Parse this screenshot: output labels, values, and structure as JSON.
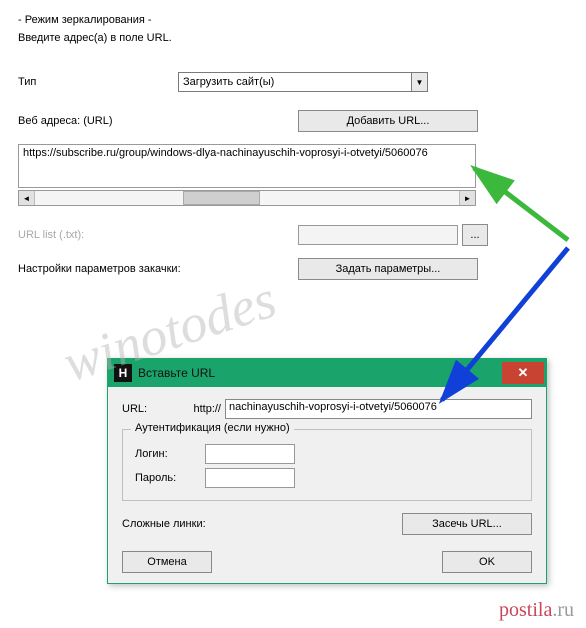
{
  "header": {
    "mode": "- Режим зеркалирования -",
    "instruction": "Введите адрес(а) в поле URL."
  },
  "type": {
    "label": "Тип",
    "value": "Загрузить сайт(ы)"
  },
  "web": {
    "label": "Веб адреса: (URL)",
    "add_btn": "Добавить URL...",
    "url_value": "https://subscribe.ru/group/windows-dlya-nachinayuschih-voprosyi-i-otvetyi/5060076"
  },
  "urllist": {
    "label": "URL list (.txt):",
    "browse": "..."
  },
  "params": {
    "label": "Настройки параметров закачки:",
    "btn": "Задать параметры..."
  },
  "dialog": {
    "title": "Вставьте URL",
    "url_label": "URL:",
    "http": "http://",
    "url_value": "nachinayuschih-voprosyi-i-otvetyi/5060076",
    "auth_legend": "Аутентификация (если нужно)",
    "login_label": "Логин:",
    "login_value": "",
    "pass_label": "Пароль:",
    "pass_value": "",
    "links_label": "Сложные линки:",
    "catch_btn": "Засечь URL...",
    "cancel": "Отмена",
    "ok": "OK"
  },
  "watermark": "winotodes",
  "footer": {
    "brand1": "postila",
    "brand2": ".ru"
  }
}
